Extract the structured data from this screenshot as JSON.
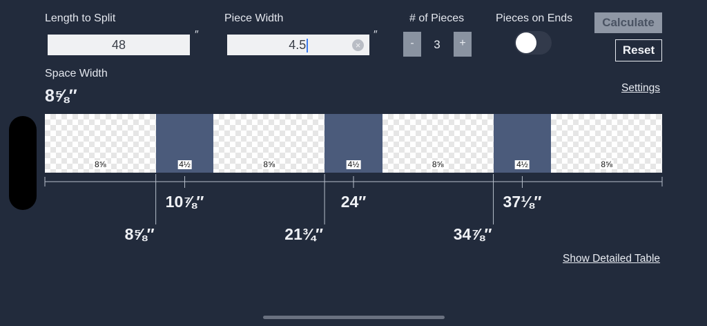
{
  "inputs": {
    "length_label": "Length to Split",
    "length_value": "48",
    "length_unit": "″",
    "width_label": "Piece Width",
    "width_value": "4.5",
    "width_unit": "″",
    "pieces_label": "# of Pieces",
    "pieces_minus": "-",
    "pieces_value": "3",
    "pieces_plus": "+",
    "ends_label": "Pieces on Ends",
    "ends_on": false
  },
  "buttons": {
    "calculate": "Calculate",
    "reset": "Reset"
  },
  "result": {
    "label": "Space Width",
    "value": "8⅝″"
  },
  "links": {
    "settings": "Settings",
    "detailed_table": "Show Detailed Table"
  },
  "diagram": {
    "segments": [
      {
        "kind": "space",
        "label": "8⅝",
        "width_in": 8.625
      },
      {
        "kind": "piece",
        "label": "4½",
        "width_in": 4.5
      },
      {
        "kind": "space",
        "label": "8⅝",
        "width_in": 8.625
      },
      {
        "kind": "piece",
        "label": "4½",
        "width_in": 4.5
      },
      {
        "kind": "space",
        "label": "8⅝",
        "width_in": 8.625
      },
      {
        "kind": "piece",
        "label": "4½",
        "width_in": 4.5
      },
      {
        "kind": "space",
        "label": "8⅝",
        "width_in": 8.625
      }
    ],
    "center_marks": [
      "10⅞″",
      "24″",
      "37⅛″"
    ],
    "edge_marks": [
      "8⅝″",
      "21¾″",
      "34⅞″"
    ]
  },
  "colors": {
    "background": "#222b3c",
    "piece": "#4b5b7b"
  }
}
